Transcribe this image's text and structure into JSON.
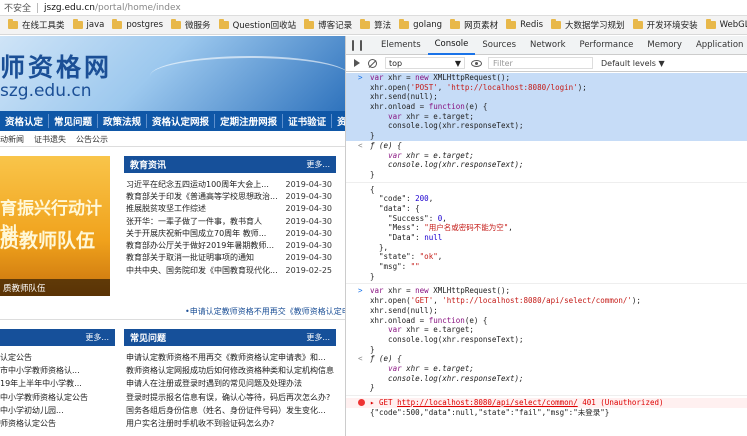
{
  "address": {
    "not_secure": "不安全",
    "host": "jszg.edu.cn",
    "path": "/portal/home/index"
  },
  "bookmarks": [
    "在线工具类",
    "java",
    "postgres",
    "微服务",
    "Question回收站",
    "博客记录",
    "算法",
    "golang",
    "网页素材",
    "Redis",
    "大数据学习规划",
    "开发环境安装",
    "WebGL",
    "大数"
  ],
  "site": {
    "banner_title": "师资格网",
    "banner_url": "szg.edu.cn",
    "nav": [
      "资格认定",
      "常见问题",
      "政策法规",
      "资格认定网报",
      "定期注册网报",
      "证书验证",
      "资格"
    ],
    "sub_links": [
      "动新闻",
      "证书遗失",
      "公告公示"
    ],
    "slide": {
      "line1": "育振兴行动计划",
      "line2": "质教师队伍",
      "caption": "质教师队伍"
    },
    "news": {
      "title": "教育资讯",
      "more": "更多...",
      "items": [
        {
          "text": "习近平在纪念五四运动100周年大会上...",
          "date": "2019-04-30"
        },
        {
          "text": "教育部关于印发《普通高等学校思想政治...",
          "date": "2019-04-30"
        },
        {
          "text": "推展脱贫攻坚工作综述",
          "date": "2019-04-30"
        },
        {
          "text": "张开华：一辈子做了一件事，教书育人",
          "date": "2019-04-30"
        },
        {
          "text": "关于开展庆祝新中国成立70周年 教师...",
          "date": "2019-04-30"
        },
        {
          "text": "教育部办公厅关于做好2019年暑期教师...",
          "date": "2019-04-30"
        },
        {
          "text": "教育部关于取消一批证明事项的通知",
          "date": "2019-04-30"
        },
        {
          "text": "中共中央、国务院印发《中国教育现代化...",
          "date": "2019-02-25"
        }
      ],
      "marquee": "•申请认定教师资格不用再交《教师资格认定申请表》和..."
    },
    "left_list": [
      "认定公告",
      "市中小学教师资格认...",
      "19年上半年中小学教...",
      "中小学教师资格认定公告",
      "中小学初幼儿园...",
      "师资格认定公告"
    ],
    "faq": {
      "title": "常见问题",
      "more": "更多...",
      "items": [
        "申请认定教师资格不用再交《教师资格认定申请表》和...",
        "教师资格认定网报成功后如何修改资格种类和认定机构信息",
        "申请人在注册或登录时遇到的常见问题及处理办法",
        "登录时提示报名信息有误，确认心等待，码后再次怎么办?",
        "国务各组后身份信息（姓名、身份证件号码）发生变化...",
        "用户实名注册时手机收不到验证码怎么办?"
      ]
    }
  },
  "devtools": {
    "tabs": [
      "Elements",
      "Console",
      "Sources",
      "Network",
      "Performance",
      "Memory",
      "Application",
      "Securit"
    ],
    "active_tab": "Console",
    "context": "top",
    "filter_placeholder": "Filter",
    "levels": "Default levels ▼",
    "console_lines": [
      {
        "text": "var xhr = new XMLHttpRequest();",
        "kind": "input",
        "hl": true
      },
      {
        "text": "xhr.open('POST', 'http://localhost:8080/login');",
        "kind": "cont",
        "hl": true
      },
      {
        "text": "xhr.send(null);",
        "kind": "cont",
        "hl": true
      },
      {
        "text": "xhr.onload = function(e) {",
        "kind": "cont",
        "hl": true
      },
      {
        "text": "    var xhr = e.target;",
        "kind": "cont",
        "hl": true
      },
      {
        "text": "    console.log(xhr.responseText);",
        "kind": "cont",
        "hl": true
      },
      {
        "text": "}",
        "kind": "cont",
        "hl": true
      },
      {
        "text": "ƒ (e) {",
        "kind": "output",
        "hl": false
      },
      {
        "text": "    var xhr = e.target;",
        "kind": "cont",
        "hl": false
      },
      {
        "text": "    console.log(xhr.responseText);",
        "kind": "cont",
        "hl": false
      },
      {
        "text": "}",
        "kind": "cont",
        "hl": false
      },
      {
        "text": "{",
        "kind": "log",
        "hl": false
      },
      {
        "text": "  \"code\": 200,",
        "kind": "cont",
        "hl": false
      },
      {
        "text": "  \"data\": {",
        "kind": "cont",
        "hl": false
      },
      {
        "text": "    \"Success\": 0,",
        "kind": "cont",
        "hl": false
      },
      {
        "text": "    \"Mess\": \"用户名或密码不能为空\",",
        "kind": "cont",
        "hl": false
      },
      {
        "text": "    \"Data\": null",
        "kind": "cont",
        "hl": false
      },
      {
        "text": "  },",
        "kind": "cont",
        "hl": false
      },
      {
        "text": "  \"state\": \"ok\",",
        "kind": "cont",
        "hl": false
      },
      {
        "text": "  \"msg\": \"\"",
        "kind": "cont",
        "hl": false
      },
      {
        "text": "}",
        "kind": "cont",
        "hl": false
      },
      {
        "text": "var xhr = new XMLHttpRequest();",
        "kind": "input",
        "hl": false
      },
      {
        "text": "xhr.open('GET', 'http://localhost:8080/api/select/common/');",
        "kind": "cont",
        "hl": false
      },
      {
        "text": "xhr.send(null);",
        "kind": "cont",
        "hl": false
      },
      {
        "text": "xhr.onload = function(e) {",
        "kind": "cont",
        "hl": false
      },
      {
        "text": "    var xhr = e.target;",
        "kind": "cont",
        "hl": false
      },
      {
        "text": "    console.log(xhr.responseText);",
        "kind": "cont",
        "hl": false
      },
      {
        "text": "}",
        "kind": "cont",
        "hl": false
      },
      {
        "text": "ƒ (e) {",
        "kind": "output",
        "hl": false
      },
      {
        "text": "    var xhr = e.target;",
        "kind": "cont",
        "hl": false
      },
      {
        "text": "    console.log(xhr.responseText);",
        "kind": "cont",
        "hl": false
      },
      {
        "text": "}",
        "kind": "cont",
        "hl": false
      }
    ],
    "error": {
      "method": "GET",
      "url": "http://localhost:8080/api/select/common/",
      "status": "401 (Unauthorized)"
    },
    "last_log": "{\"code\":500,\"data\":null,\"state\":\"fail\",\"msg\":\"未登录\"}"
  }
}
